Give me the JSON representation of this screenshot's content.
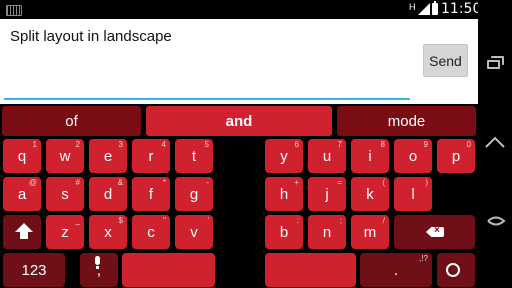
{
  "status_bar": {
    "keyboard_icon": "keyboard-icon",
    "network_label": "H",
    "time": "11:50"
  },
  "compose": {
    "text": "Split layout in landscape",
    "send_label": "Send"
  },
  "suggestions": [
    "of",
    "and",
    "mode"
  ],
  "keyboard": {
    "rows": [
      [
        {
          "main": "q",
          "hint": "1"
        },
        {
          "main": "w",
          "hint": "2"
        },
        {
          "main": "e",
          "hint": "3"
        },
        {
          "main": "r",
          "hint": "4"
        },
        {
          "main": "t",
          "hint": "5"
        },
        {
          "main": "y",
          "hint": "6"
        },
        {
          "main": "u",
          "hint": "7"
        },
        {
          "main": "i",
          "hint": "8"
        },
        {
          "main": "o",
          "hint": "9"
        },
        {
          "main": "p",
          "hint": "0"
        }
      ],
      [
        {
          "main": "a",
          "hint": "@"
        },
        {
          "main": "s",
          "hint": "#"
        },
        {
          "main": "d",
          "hint": "&"
        },
        {
          "main": "f",
          "hint": "*"
        },
        {
          "main": "g",
          "hint": "-"
        },
        {
          "main": "h",
          "hint": "+"
        },
        {
          "main": "j",
          "hint": "="
        },
        {
          "main": "k",
          "hint": "("
        },
        {
          "main": "l",
          "hint": ")"
        }
      ],
      [
        {
          "main": "z",
          "hint": "_"
        },
        {
          "main": "x",
          "hint": "$"
        },
        {
          "main": "c",
          "hint": "\""
        },
        {
          "main": "v",
          "hint": "'"
        },
        {
          "main": "b",
          "hint": ":"
        },
        {
          "main": "n",
          "hint": ";"
        },
        {
          "main": "m",
          "hint": "/"
        }
      ]
    ],
    "num_key": "123",
    "comma_key": ",",
    "period_key": ".",
    "punct_hint": ",!?",
    "mic_icon": "mic-icon",
    "shift_icon": "shift-icon",
    "backspace_icon": "backspace-icon",
    "emoji_icon": "smiley-icon"
  },
  "colors": {
    "accent": "#d0222e",
    "dark_key": "#6f0f17",
    "focus_underline": "#33b5e5"
  }
}
